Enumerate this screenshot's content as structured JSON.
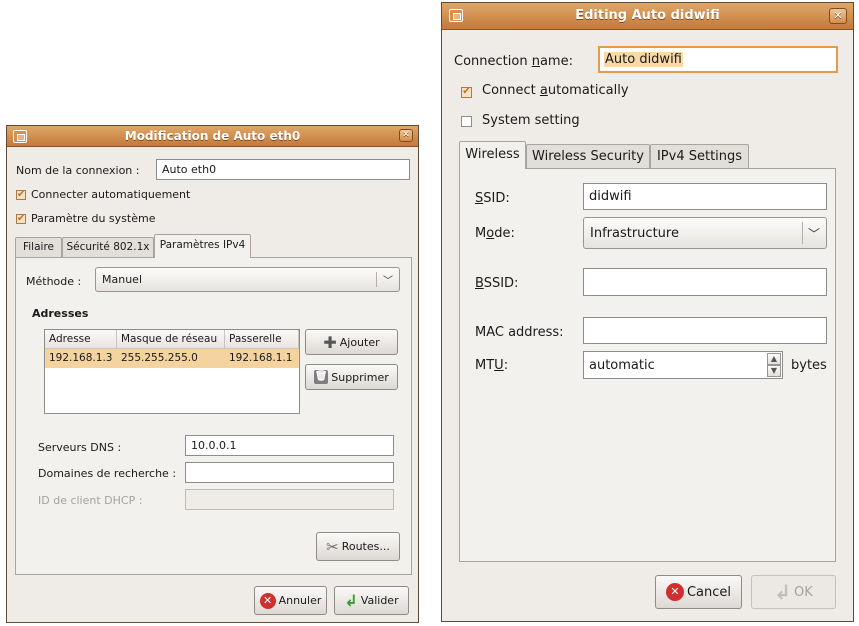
{
  "left_dialog": {
    "title": "Modification de Auto eth0",
    "connection_name_label": "Nom de la connexion :",
    "connection_name_value": "Auto eth0",
    "connect_auto_label": "Connecter automatiquement",
    "connect_auto_checked": true,
    "system_param_label": "Paramètre du système",
    "system_param_checked": true,
    "tabs": [
      {
        "label": "Filaire",
        "active": false
      },
      {
        "label": "Sécurité 802.1x",
        "active": false
      },
      {
        "label": "Paramètres IPv4",
        "active": true
      }
    ],
    "method_label": "Méthode :",
    "method_value": "Manuel",
    "addresses_heading": "Adresses",
    "address_columns": [
      "Adresse",
      "Masque de réseau",
      "Passerelle"
    ],
    "address_rows": [
      [
        "192.168.1.3",
        "255.255.255.0",
        "192.168.1.1"
      ]
    ],
    "add_button": "Ajouter",
    "delete_button": "Supprimer",
    "dns_label": "Serveurs DNS :",
    "dns_value": "10.0.0.1",
    "search_domains_label": "Domaines de recherche :",
    "search_domains_value": "",
    "dhcp_client_id_label": "ID de client DHCP :",
    "dhcp_client_id_value": "",
    "routes_button": "Routes...",
    "cancel_button": "Annuler",
    "ok_button": "Valider"
  },
  "right_dialog": {
    "title": "Editing Auto didwifi",
    "connection_name_label": "Connection name:",
    "connection_name_value": "Auto didwifi",
    "connect_auto_label": "Connect automatically",
    "connect_auto_checked": true,
    "system_setting_label": "System setting",
    "system_setting_checked": false,
    "tabs": [
      {
        "label": "Wireless",
        "active": true
      },
      {
        "label": "Wireless Security",
        "active": false
      },
      {
        "label": "IPv4 Settings",
        "active": false
      }
    ],
    "ssid_label": "SSID:",
    "ssid_value": "didwifi",
    "mode_label": "Mode:",
    "mode_value": "Infrastructure",
    "bssid_label": "BSSID:",
    "bssid_value": "",
    "mac_label": "MAC address:",
    "mac_value": "",
    "mtu_label": "MTU:",
    "mtu_value": "automatic",
    "mtu_unit": "bytes",
    "cancel_button": "Cancel",
    "ok_button": "OK"
  },
  "colors": {
    "titlebar": "#c3793a",
    "dialog_bg": "#efebe7",
    "selection": "#f5d39f",
    "focus": "#e59a4c"
  }
}
